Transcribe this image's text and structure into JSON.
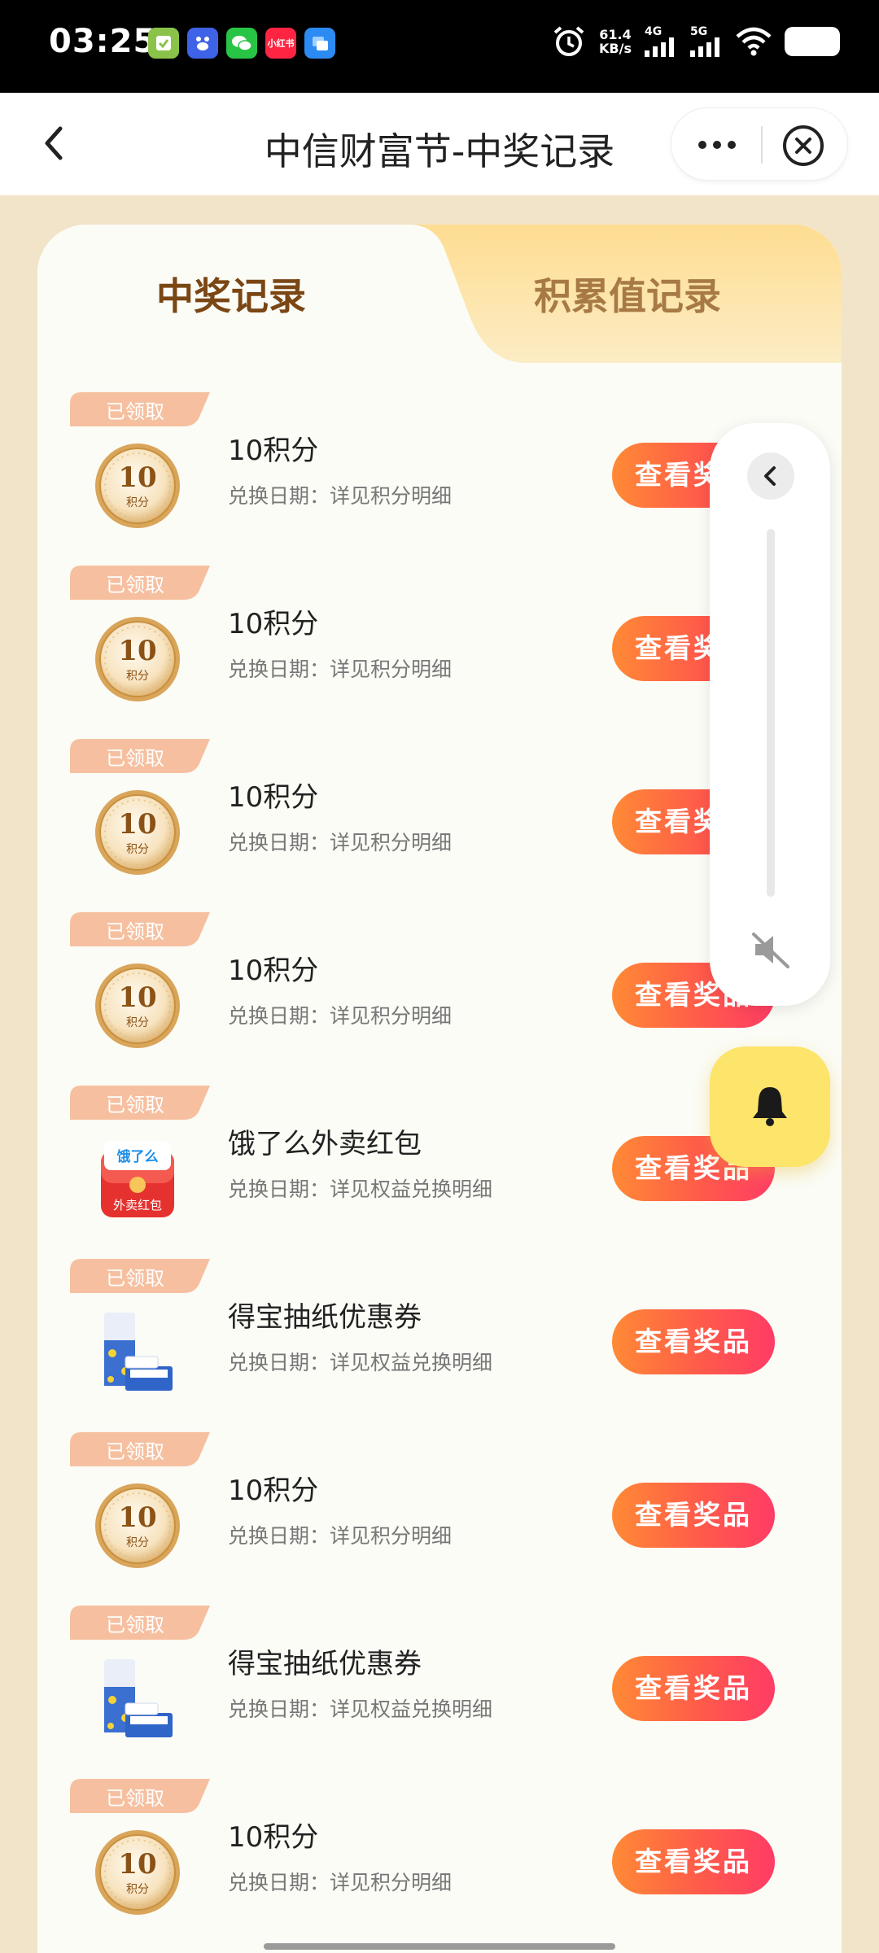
{
  "status_bar": {
    "time": "03:25",
    "net_speed_value": "61.4",
    "net_speed_unit": "KB/s",
    "sim1": "4G",
    "sim2": "5G",
    "apps": [
      {
        "icon": "todo-app-icon",
        "color": "#8bc34a"
      },
      {
        "icon": "baidu-app-icon",
        "color": "#3f63e6"
      },
      {
        "icon": "wechat-app-icon",
        "color": "#28c445"
      },
      {
        "icon": "xiaohongshu-app-icon",
        "color": "#ff2442",
        "text": "小红书"
      },
      {
        "icon": "blue-app-icon",
        "color": "#2b8bf2"
      }
    ]
  },
  "header": {
    "title": "中信财富节-中奖记录"
  },
  "tabs": [
    {
      "label": "中奖记录",
      "active": true
    },
    {
      "label": "积累值记录",
      "active": false
    }
  ],
  "records": [
    {
      "status": "已领取",
      "name": "10积分",
      "date": "兑换日期：详见积分明细",
      "button": "查看奖品",
      "thumb": "points-coin-icon"
    },
    {
      "status": "已领取",
      "name": "10积分",
      "date": "兑换日期：详见积分明细",
      "button": "查看奖品",
      "thumb": "points-coin-icon"
    },
    {
      "status": "已领取",
      "name": "10积分",
      "date": "兑换日期：详见积分明细",
      "button": "查看奖品",
      "thumb": "points-coin-icon"
    },
    {
      "status": "已领取",
      "name": "10积分",
      "date": "兑换日期：详见积分明细",
      "button": "查看奖品",
      "thumb": "points-coin-icon"
    },
    {
      "status": "已领取",
      "name": "饿了么外卖红包",
      "date": "兑换日期：详见权益兑换明细",
      "button": "查看奖品",
      "thumb": "eleme-red-packet-icon"
    },
    {
      "status": "已领取",
      "name": "得宝抽纸优惠券",
      "date": "兑换日期：详见权益兑换明细",
      "button": "查看奖品",
      "thumb": "tempo-tissue-icon"
    },
    {
      "status": "已领取",
      "name": "10积分",
      "date": "兑换日期：详见积分明细",
      "button": "查看奖品",
      "thumb": "points-coin-icon"
    },
    {
      "status": "已领取",
      "name": "得宝抽纸优惠券",
      "date": "兑换日期：详见权益兑换明细",
      "button": "查看奖品",
      "thumb": "tempo-tissue-icon"
    },
    {
      "status": "已领取",
      "name": "10积分",
      "date": "兑换日期：详见积分明细",
      "button": "查看奖品",
      "thumb": "points-coin-icon"
    }
  ],
  "coin": {
    "number": "10",
    "unit": "积分"
  },
  "eleme": {
    "brand": "饿了么",
    "label": "外卖红包"
  },
  "colors": {
    "button_gradient_start": "#ff8a35",
    "button_gradient_end": "#ff3c66",
    "badge": "#f6c0a0",
    "active_tab_text": "#7a4614",
    "inactive_tab_text": "#a77a45",
    "bell_button": "#fde46a"
  }
}
